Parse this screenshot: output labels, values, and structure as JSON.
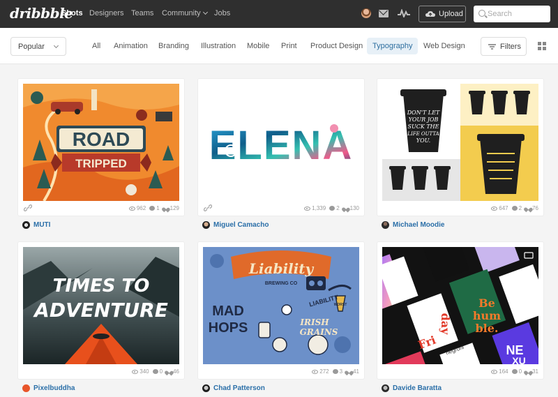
{
  "header": {
    "logo": "dribbble",
    "nav": [
      {
        "label": "Shots",
        "active": true
      },
      {
        "label": "Designers",
        "active": false
      },
      {
        "label": "Teams",
        "active": false
      },
      {
        "label": "Community",
        "active": false,
        "dropdown": true
      },
      {
        "label": "Jobs",
        "active": false
      }
    ],
    "upload_label": "Upload",
    "search_placeholder": "Search"
  },
  "filters": {
    "sort_selected": "Popular",
    "categories": [
      {
        "label": "All",
        "active": false
      },
      {
        "label": "Animation",
        "active": false
      },
      {
        "label": "Branding",
        "active": false
      },
      {
        "label": "Illustration",
        "active": false
      },
      {
        "label": "Mobile",
        "active": false
      },
      {
        "label": "Print",
        "active": false
      },
      {
        "label": "Product Design",
        "active": false
      },
      {
        "label": "Typography",
        "active": true
      },
      {
        "label": "Web Design",
        "active": false
      }
    ],
    "filters_label": "Filters"
  },
  "shots": [
    {
      "author": "MUTI",
      "views": "962",
      "comments": "1",
      "likes": "129",
      "has_link": true,
      "art_text": [
        "ROAD",
        "TRIPPED"
      ]
    },
    {
      "author": "Miguel Camacho",
      "views": "1,339",
      "comments": "2",
      "likes": "130",
      "has_link": true,
      "art_text": [
        "ELENA"
      ]
    },
    {
      "author": "Michael Moodie",
      "views": "647",
      "comments": "2",
      "likes": "76",
      "has_link": false,
      "art_text": [
        "DON'T LET",
        "YOUR JOB",
        "SUCK THE",
        "LIFE OUTTA",
        "YOU."
      ]
    },
    {
      "author": "Pixelbuddha",
      "views": "340",
      "comments": "0",
      "likes": "46",
      "has_link": false,
      "art_text": [
        "TIMES TO",
        "ADVENTURE"
      ]
    },
    {
      "author": "Chad Patterson",
      "views": "272",
      "comments": "3",
      "likes": "41",
      "has_link": false,
      "art_text": [
        "Liability",
        "BREWING CO",
        "MAD",
        "HOPS",
        "LIABILITY",
        "IRISH",
        "GRAINS",
        "WORST"
      ]
    },
    {
      "author": "Davide Baratta",
      "views": "164",
      "comments": "0",
      "likes": "31",
      "has_link": false,
      "art_text": [
        "Be",
        "hum",
        "ble.",
        "day",
        "Fri",
        "negroni",
        "NE",
        "XU"
      ]
    }
  ],
  "colors": {
    "topbar": "#2f2f2f",
    "accent_blue": "#2b6fa8",
    "active_tab_bg": "#e7f0f7"
  }
}
